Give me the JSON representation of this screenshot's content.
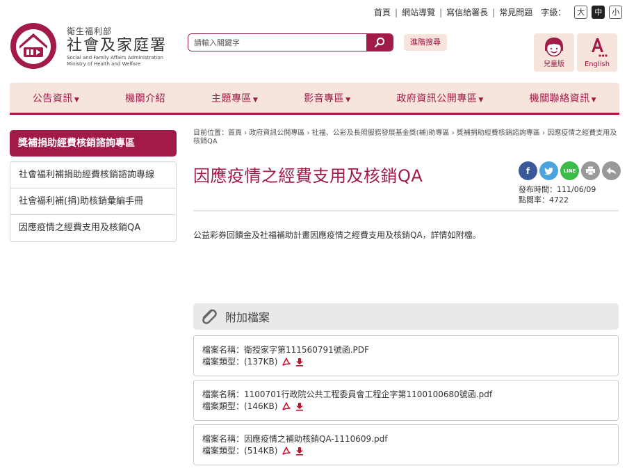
{
  "top_links": [
    "首頁",
    "網站導覽",
    "寫信給署長",
    "常見問題"
  ],
  "font_size": {
    "label": "字級：",
    "options": [
      "大",
      "中",
      "小"
    ],
    "active": "中"
  },
  "logo": {
    "ministry": "衛生福利部",
    "name": "社會及家庭署",
    "en_line1": "Social and Family Affairs Administration",
    "en_line2": "Ministry of Health and Welfare"
  },
  "search": {
    "placeholder": "請輸入關鍵字",
    "advanced_label": "進階搜尋"
  },
  "quick_links": {
    "kids_label": "兒童版",
    "english_label": "English"
  },
  "nav": [
    "公告資訊",
    "機關介紹",
    "主題專區",
    "影音專區",
    "政府資訊公開專區",
    "機關聯絡資訊"
  ],
  "sidebar": {
    "heading": "獎補捐助經費核銷諮詢專區",
    "items": [
      "社會福利補捐助經費核銷諮詢專線",
      "社會福利補(捐)助核銷彙編手冊",
      "因應疫情之經費支用及核銷QA"
    ]
  },
  "breadcrumb": {
    "prefix": "目前位置：",
    "items": [
      "首頁",
      "政府資訊公開專區",
      "社福、公彩及長照服務發展基金獎(補)助專區",
      "獎補捐助經費核銷諮詢專區",
      "因應疫情之經費支用及核銷QA"
    ]
  },
  "article": {
    "title": "因應疫情之經費支用及核銷QA",
    "publish_label": "發布時間：",
    "publish_date": "111/06/09",
    "hits_label": "點閱率：",
    "hits": "4722",
    "body": "公益彩券回饋金及社福補助計畫因應疫情之經費支用及核銷QA，詳情如附檔。"
  },
  "attachments": {
    "heading": "附加檔案",
    "name_label": "檔案名稱：",
    "type_label": "檔案類型：",
    "files": [
      {
        "name": "衛授家字第111560791號函.PDF",
        "size": "(137KB)"
      },
      {
        "name": "1100701行政院公共工程委員會工程企字第1100100680號函.pdf",
        "size": "(146KB)"
      },
      {
        "name": "因應疫情之補助核銷QA-1110609.pdf",
        "size": "(514KB)"
      }
    ]
  },
  "colors": {
    "brand": "#a11a48",
    "nav_bg": "#f7e4dc",
    "att_head_bg": "#e9e9e9"
  }
}
